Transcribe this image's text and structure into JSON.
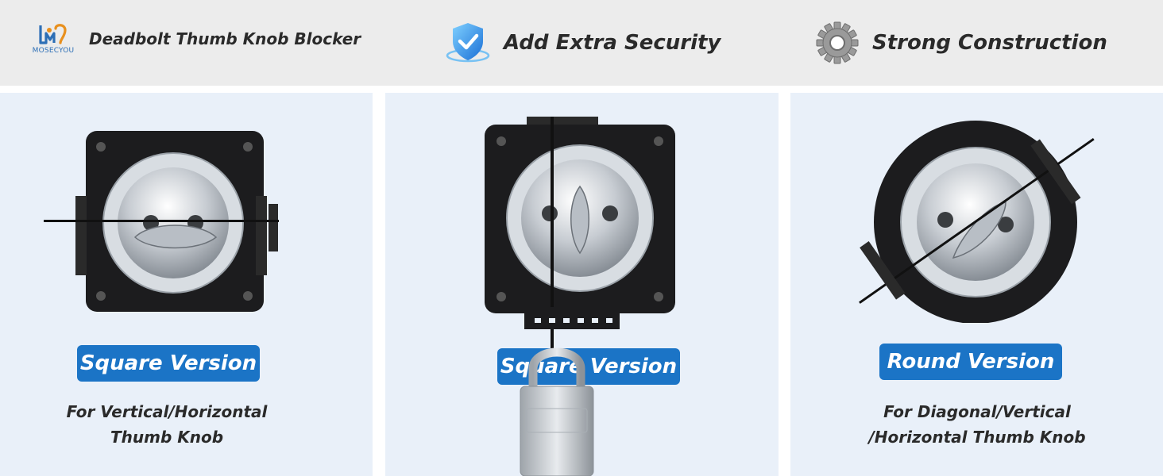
{
  "header": {
    "brand": {
      "name": "MOSECYOU",
      "icon": "mosecyou-logo-icon"
    },
    "features": [
      {
        "label": "Deadbolt Thumb Knob Blocker",
        "icon": "mosecyou-logo-icon"
      },
      {
        "label": "Add Extra Security",
        "icon": "shield-check-icon"
      },
      {
        "label": "Strong Construction",
        "icon": "gear-icon"
      }
    ]
  },
  "panels": [
    {
      "badge": "Square Version",
      "description_lines": [
        "For Vertical/Horizontal",
        "Thumb Knob"
      ]
    },
    {
      "badge": "Square Version",
      "description_lines": []
    },
    {
      "badge": "Round Version",
      "description_lines": [
        "For Diagonal/Vertical",
        "/Horizontal Thumb Knob"
      ]
    }
  ],
  "colors": {
    "header_bg": "#ececec",
    "panel_bg": "#e9f0f9",
    "badge_bg": "#1b74c6",
    "text": "#2a2a2a",
    "brand": "#2d6fb6"
  }
}
